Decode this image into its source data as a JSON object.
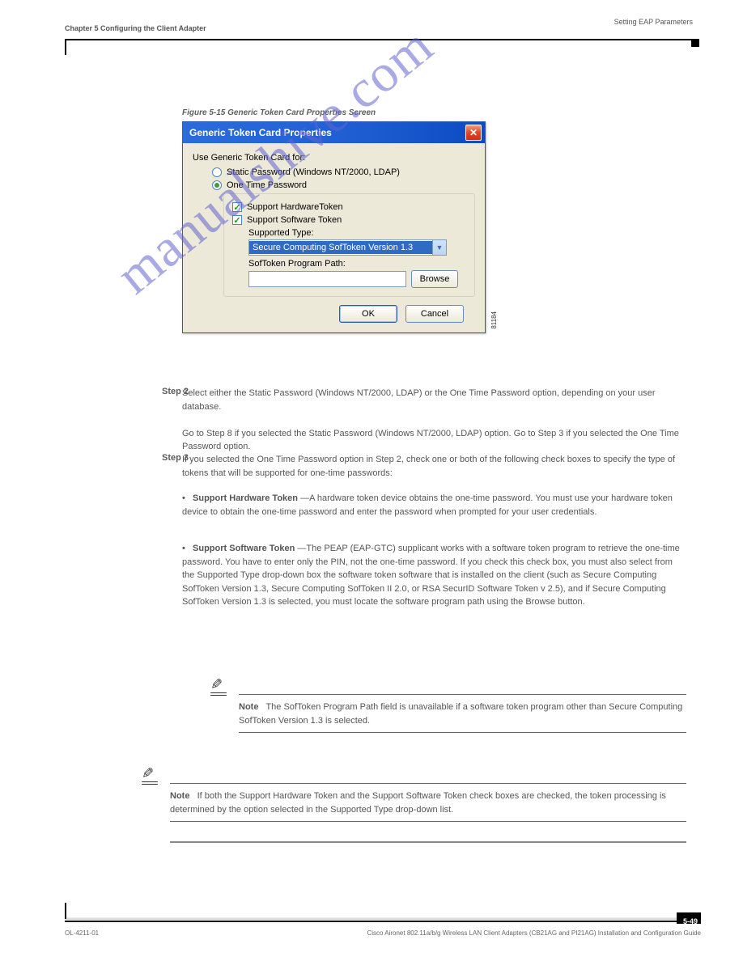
{
  "header": {
    "chapter_left": "Chapter 5      Configuring the Client Adapter",
    "section_right": "Setting EAP Parameters"
  },
  "figure_caption": "Figure 5-15   Generic Token Card Properties Screen",
  "dialog": {
    "title": "Generic Token Card Properties",
    "close_glyph": "✕",
    "use_label": "Use Generic Token Card for:",
    "radio_static": "Static Password (Windows NT/2000, LDAP)",
    "radio_otp": "One Time Password",
    "check_hw": "Support HardwareToken",
    "check_sw": "Support Software Token",
    "supported_type_label": "Supported Type:",
    "supported_type_value": "Secure Computing SofToken Version 1.3",
    "path_label": "SofToken Program Path:",
    "path_value": "",
    "browse": "Browse",
    "ok": "OK",
    "cancel": "Cancel",
    "figure_id": "81184"
  },
  "watermark": "manualshive.com",
  "content": {
    "step2_num": "Step 2",
    "step2_text": "Select either the Static Password (Windows NT/2000, LDAP) or the One Time Password option, depending on your user database.",
    "step2_note": "Go to Step 8 if you selected the Static Password (Windows NT/2000, LDAP) option. Go to Step 3 if you selected the One Time Password option.",
    "step3_num": "Step 3",
    "step3_text": "If you selected the One Time Password option in Step 2, check one or both of the following check boxes to specify the type of tokens that will be supported for one-time passwords:",
    "bullet_hw_title": "Support Hardware Token",
    "bullet_hw_text": "—A hardware token device obtains the one-time password. You must use your hardware token device to obtain the one-time password and enter the password when prompted for your user credentials.",
    "bullet_sw_title": "Support Software Token",
    "bullet_sw_text": "—The PEAP (EAP-GTC) supplicant works with a software token program to retrieve the one-time password. You have to enter only the PIN, not the one-time password. If you check this check box, you must also select from the Supported Type drop-down box the software token software that is installed on the client (such as Secure Computing SofToken Version 1.3, Secure Computing SofToken II 2.0, or RSA SecurID Software Token v 2.5), and if Secure Computing SofToken Version 1.3 is selected, you must locate the software program path using the Browse button.",
    "note1_label": "Note",
    "note1_text": "The SofToken Program Path field is unavailable if a software token program other than Secure Computing SofToken Version 1.3 is selected.",
    "note2_label": "Note",
    "note2_text": "If both the Support Hardware Token and the Support Software Token check boxes are checked, the token processing is determined by the option selected in the Supported Type drop-down list."
  },
  "footer": {
    "doc_title": "Cisco Aironet 802.11a/b/g Wireless LAN Client Adapters (CB21AG and PI21AG) Installation and Configuration Guide",
    "doc_code": "OL-4211-01",
    "page_num": "5-49"
  }
}
